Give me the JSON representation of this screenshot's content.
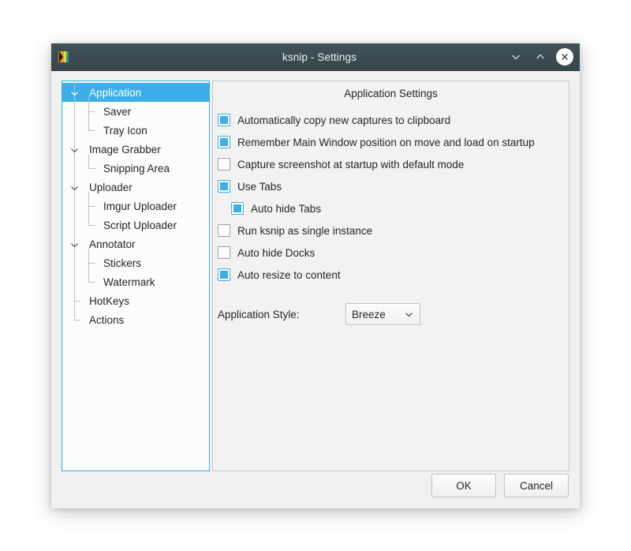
{
  "window": {
    "title": "ksnip - Settings",
    "icon": "ksnip-app-icon",
    "controls": {
      "minimize": "chevron-down-icon",
      "maximize": "chevron-up-icon",
      "close": "close-icon"
    }
  },
  "sidebar": {
    "items": [
      {
        "label": "Application",
        "level": 0,
        "expandable": true,
        "selected": true
      },
      {
        "label": "Saver",
        "level": 1,
        "expandable": false,
        "selected": false
      },
      {
        "label": "Tray Icon",
        "level": 1,
        "expandable": false,
        "selected": false
      },
      {
        "label": "Image Grabber",
        "level": 0,
        "expandable": true,
        "selected": false
      },
      {
        "label": "Snipping Area",
        "level": 1,
        "expandable": false,
        "selected": false
      },
      {
        "label": "Uploader",
        "level": 0,
        "expandable": true,
        "selected": false
      },
      {
        "label": "Imgur Uploader",
        "level": 1,
        "expandable": false,
        "selected": false
      },
      {
        "label": "Script Uploader",
        "level": 1,
        "expandable": false,
        "selected": false
      },
      {
        "label": "Annotator",
        "level": 0,
        "expandable": true,
        "selected": false
      },
      {
        "label": "Stickers",
        "level": 1,
        "expandable": false,
        "selected": false
      },
      {
        "label": "Watermark",
        "level": 1,
        "expandable": false,
        "selected": false
      },
      {
        "label": "HotKeys",
        "level": 0,
        "expandable": false,
        "selected": false
      },
      {
        "label": "Actions",
        "level": 0,
        "expandable": false,
        "selected": false
      }
    ]
  },
  "panel": {
    "title": "Application Settings",
    "options": [
      {
        "label": "Automatically copy new captures to clipboard",
        "checked": true,
        "indent": false
      },
      {
        "label": "Remember Main Window position on move and load on startup",
        "checked": true,
        "indent": false
      },
      {
        "label": "Capture screenshot at startup with default mode",
        "checked": false,
        "indent": false
      },
      {
        "label": "Use Tabs",
        "checked": true,
        "indent": false
      },
      {
        "label": "Auto hide Tabs",
        "checked": true,
        "indent": true
      },
      {
        "label": "Run ksnip as single instance",
        "checked": false,
        "indent": false
      },
      {
        "label": "Auto hide Docks",
        "checked": false,
        "indent": false
      },
      {
        "label": "Auto resize to content",
        "checked": true,
        "indent": false
      }
    ],
    "style_field": {
      "label": "Application Style:",
      "value": "Breeze",
      "arrow": "chevron-down-icon"
    }
  },
  "buttons": {
    "ok": "OK",
    "cancel": "Cancel"
  },
  "colors": {
    "accent": "#3daee9",
    "titlebar": "#3b4a52",
    "panel_bg": "#f2f2f2",
    "dialog_bg": "#eff0f1",
    "text": "#232629"
  }
}
